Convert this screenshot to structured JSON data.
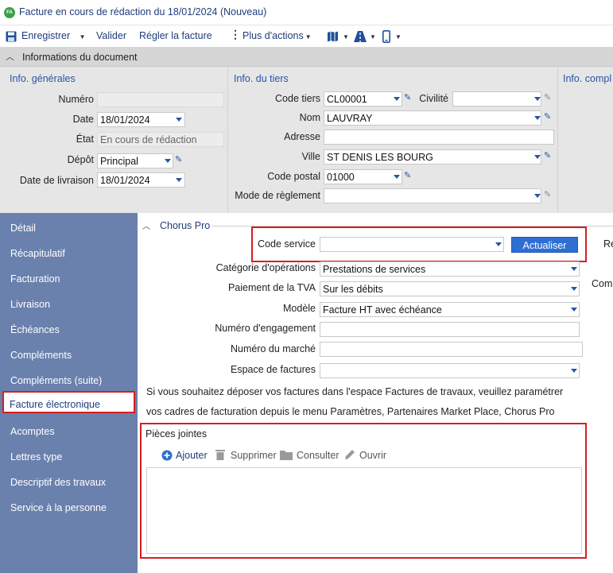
{
  "window": {
    "title": "Facture en cours de rédaction du 18/01/2024 (Nouveau)",
    "logo": "FA"
  },
  "toolbar": {
    "save_label": "Enregistrer",
    "validate_label": "Valider",
    "pay_label": "Régler la facture",
    "more_label": "Plus d'actions"
  },
  "document_info": {
    "section_title": "Informations du document",
    "general": {
      "group_title": "Info. générales",
      "numero_label": "Numéro",
      "numero_value": "",
      "date_label": "Date",
      "date_value": "18/01/2024",
      "etat_label": "État",
      "etat_value": "En cours de rédaction",
      "depot_label": "Dépôt",
      "depot_value": "Principal",
      "livraison_label": "Date de livraison",
      "livraison_value": "18/01/2024"
    },
    "tiers": {
      "group_title": "Info. du tiers",
      "code_label": "Code tiers",
      "code_value": "CL00001",
      "civilite_label": "Civilité",
      "civilite_value": "",
      "nom_label": "Nom",
      "nom_value": "LAUVRAY",
      "adresse_label": "Adresse",
      "adresse_value": "",
      "ville_label": "Ville",
      "ville_value": "ST DENIS LES BOURG",
      "cp_label": "Code postal",
      "cp_value": "01000",
      "reglement_label": "Mode de règlement",
      "reglement_value": ""
    },
    "compl": {
      "group_title": "Info. compl"
    }
  },
  "sidebar": {
    "items": [
      {
        "label": "Détail"
      },
      {
        "label": "Récapitulatif"
      },
      {
        "label": "Facturation"
      },
      {
        "label": "Livraison"
      },
      {
        "label": "Échéances"
      },
      {
        "label": "Compléments"
      },
      {
        "label": "Compléments (suite)"
      },
      {
        "label": "Facture électronique"
      },
      {
        "label": "Acomptes"
      },
      {
        "label": "Lettres type"
      },
      {
        "label": "Descriptif des travaux"
      },
      {
        "label": "Service à la personne"
      }
    ],
    "active_index": 7
  },
  "chorus": {
    "section_title": "Chorus Pro",
    "code_service_label": "Code service",
    "code_service_value": "",
    "refresh_label": "Actualiser",
    "categorie_label": "Catégorie d'opérations",
    "categorie_value": "Prestations de services",
    "tva_label": "Paiement de la TVA",
    "tva_value": "Sur les débits",
    "modele_label": "Modèle",
    "modele_value": "Facture HT avec échéance",
    "engagement_label": "Numéro d'engagement",
    "engagement_value": "",
    "marche_label": "Numéro du marché",
    "marche_value": "",
    "espace_label": "Espace de factures",
    "espace_value": "",
    "info_line1": "Si vous souhaitez déposer vos factures dans l'espace Factures de travaux, veuillez paramétrer",
    "info_line2": "vos cadres de facturation depuis le menu Paramètres, Partenaires Market Place, Chorus Pro",
    "right_clip1": "Re",
    "right_clip2": "Comm"
  },
  "attachments": {
    "title": "Pièces jointes",
    "add_label": "Ajouter",
    "delete_label": "Supprimer",
    "view_label": "Consulter",
    "open_label": "Ouvrir"
  },
  "colors": {
    "accent": "#2a54a6",
    "sidebar": "#6a80ad",
    "highlight": "#d42020",
    "button": "#2d6fd2"
  }
}
